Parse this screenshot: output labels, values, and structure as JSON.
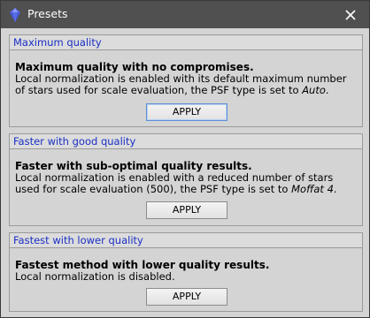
{
  "window": {
    "title": "Presets",
    "app_icon": "gem-icon",
    "close_icon": "close-icon"
  },
  "presets": [
    {
      "header": "Maximum quality",
      "title": "Maximum quality with no compromises.",
      "desc_before": "Local normalization is enabled with its default maximum number of stars used for scale evaluation, the PSF type is set to ",
      "desc_em": "Auto",
      "desc_after": ".",
      "button": "APPLY"
    },
    {
      "header": "Faster with good quality",
      "title": "Faster with sub-optimal quality results.",
      "desc_before": "Local normalization is enabled with a reduced number of stars used for scale evaluation (500), the PSF type is set to ",
      "desc_em": "Moffat 4",
      "desc_after": ".",
      "button": "APPLY"
    },
    {
      "header": "Fastest with lower quality",
      "title": "Fastest method with lower quality results.",
      "desc_before": "Local normalization is disabled.",
      "desc_em": "",
      "desc_after": "",
      "button": "APPLY"
    }
  ],
  "colors": {
    "titlebar": "#505050",
    "header_text": "#1a2fc4",
    "panel": "#d4d4d4"
  }
}
